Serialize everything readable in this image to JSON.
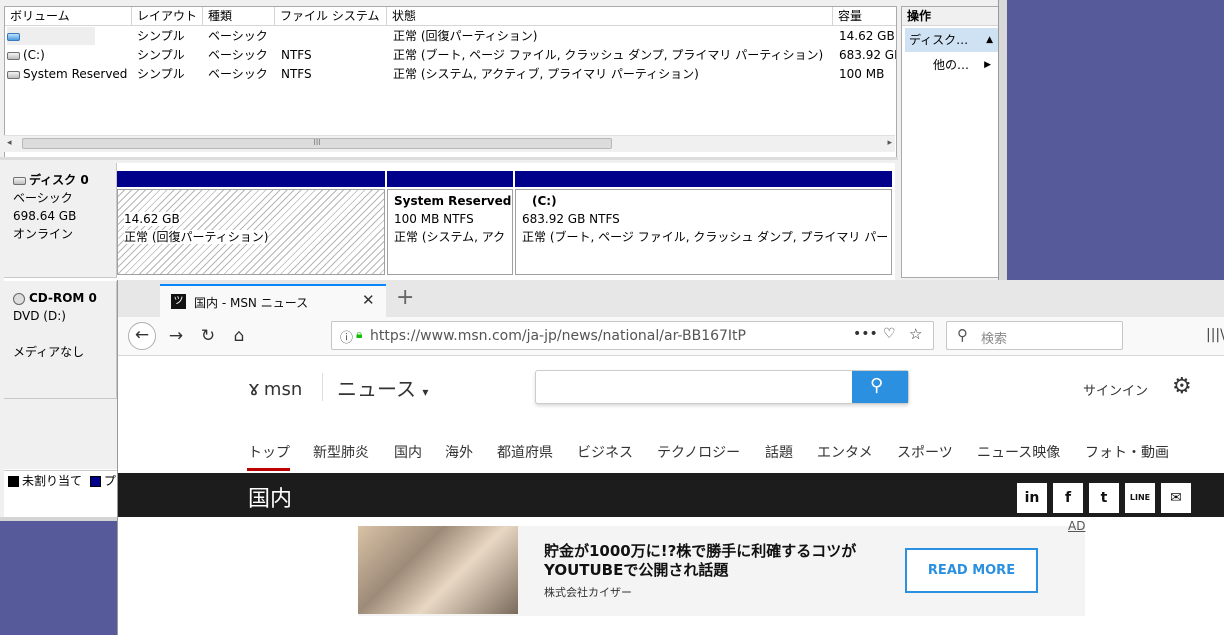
{
  "disk_mgmt": {
    "columns": [
      "ボリューム",
      "レイアウト",
      "種類",
      "ファイル システム",
      "状態",
      "容量"
    ],
    "volumes": [
      {
        "name": "",
        "layout": "シンプル",
        "type": "ベーシック",
        "fs": "",
        "status": "正常 (回復パーティション)",
        "capacity": "14.62 GB"
      },
      {
        "name": "(C:)",
        "layout": "シンプル",
        "type": "ベーシック",
        "fs": "NTFS",
        "status": "正常 (ブート, ページ ファイル, クラッシュ ダンプ, プライマリ パーティション)",
        "capacity": "683.92 GB"
      },
      {
        "name": "System Reserved",
        "layout": "シンプル",
        "type": "ベーシック",
        "fs": "NTFS",
        "status": "正常 (システム, アクティブ, プライマリ パーティション)",
        "capacity": "100 MB"
      }
    ],
    "scroll_thumb_label": "III",
    "disk0": {
      "name": "ディスク 0",
      "type": "ベーシック",
      "size": "698.64 GB",
      "state": "オンライン"
    },
    "partitions": [
      {
        "title": "",
        "size": "14.62 GB",
        "status": "正常 (回復パーティション)"
      },
      {
        "title": "System Reserved",
        "size": "100 MB NTFS",
        "status": "正常 (システム, アク"
      },
      {
        "title": "(C:)",
        "size": "683.92 GB NTFS",
        "status": "正常 (ブート, ページ ファイル, クラッシュ ダンプ, プライマリ パー"
      }
    ],
    "cdrom": {
      "name": "CD-ROM 0",
      "type": "DVD (D:)",
      "media": "メディアなし"
    },
    "legend": {
      "unallocated": "未割り当て",
      "primary": "プ"
    }
  },
  "actions": {
    "title": "操作",
    "item1": "ディスク…",
    "item2": "他の…"
  },
  "browser": {
    "tab_title": "国内 - MSN ニュース",
    "url": "https://www.msn.com/ja-jp/news/national/ar-BB167ItP",
    "search_placeholder": "検索"
  },
  "msn": {
    "logo": "msn",
    "section": "ニュース",
    "signin": "サインイン",
    "nav": [
      "トップ",
      "新型肺炎",
      "国内",
      "海外",
      "都道府県",
      "ビジネス",
      "テクノロジー",
      "話題",
      "エンタメ",
      "スポーツ",
      "ニュース映像",
      "フォト・動画"
    ],
    "band_title": "国内",
    "share": [
      "in",
      "f",
      "t",
      "LINE",
      "mail"
    ],
    "ad": {
      "title": "貯金が1000万に!?株で勝手に利確するコツがYOUTUBEで公開され話題",
      "source": "株式会社カイザー",
      "button": "READ MORE",
      "tag": "AD"
    }
  },
  "colors": {
    "accent": "#0a84ff",
    "msn_blue": "#2b90e0",
    "partition_header": "#00008b",
    "nav_active": "#bb0000"
  }
}
